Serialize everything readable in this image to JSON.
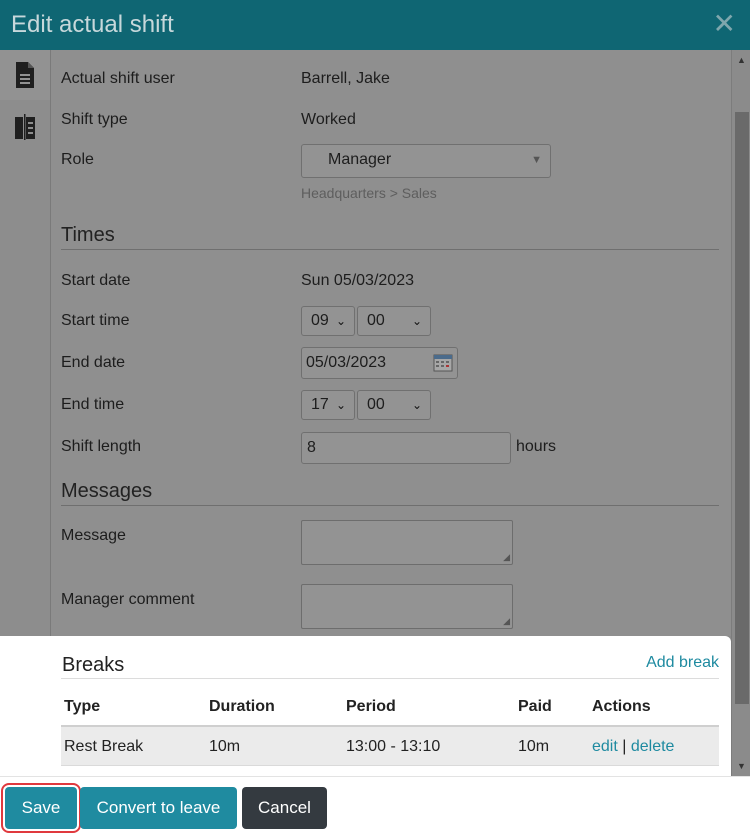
{
  "dialog": {
    "title": "Edit actual shift",
    "close_symbol": "✕"
  },
  "sidebar": {
    "tabs": [
      {
        "icon": "document-icon"
      },
      {
        "icon": "compare-icon"
      }
    ]
  },
  "fields": {
    "user_label": "Actual shift user",
    "user_value": "Barrell, Jake",
    "type_label": "Shift type",
    "type_value": "Worked",
    "role_label": "Role",
    "role_value": "Manager",
    "role_path": "Headquarters > Sales"
  },
  "times": {
    "heading": "Times",
    "start_date_label": "Start date",
    "start_date_value": "Sun 05/03/2023",
    "start_time_label": "Start time",
    "start_hour": "09",
    "start_minute": "00",
    "end_date_label": "End date",
    "end_date_value": "05/03/2023",
    "end_time_label": "End time",
    "end_hour": "17",
    "end_minute": "00",
    "length_label": "Shift length",
    "length_value": "8",
    "length_unit": "hours"
  },
  "messages": {
    "heading": "Messages",
    "message_label": "Message",
    "comment_label": "Manager comment"
  },
  "breaks": {
    "heading": "Breaks",
    "add_label": "Add break",
    "columns": [
      "Type",
      "Duration",
      "Period",
      "Paid",
      "Actions"
    ],
    "rows": [
      {
        "type": "Rest Break",
        "duration": "10m",
        "period": "13:00 - 13:10",
        "paid": "10m",
        "edit": "edit",
        "sep": "|",
        "delete": "delete"
      }
    ]
  },
  "footer": {
    "save": "Save",
    "convert": "Convert to leave",
    "cancel": "Cancel"
  }
}
